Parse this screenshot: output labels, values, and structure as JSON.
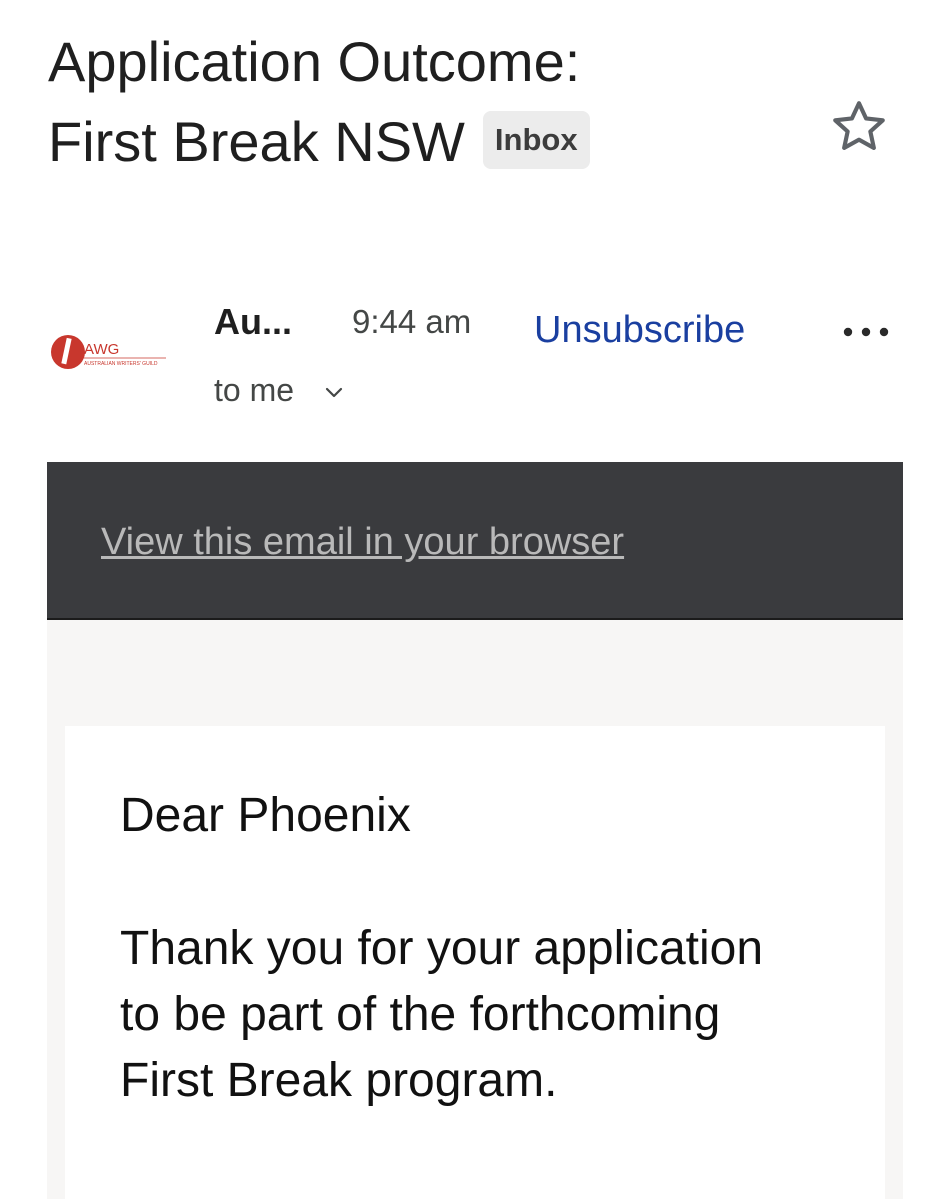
{
  "email": {
    "subject_line_1": "Application Outcome:",
    "subject_line_2": "First Break NSW",
    "label": "Inbox",
    "sender": "Au...",
    "time": "9:44 am",
    "unsubscribe": "Unsubscribe",
    "recipient": "to me",
    "avatar": {
      "logo_text": "AWG",
      "logo_subtext": "AUSTRALIAN WRITERS' GUILD",
      "brand_color": "#c8372d"
    }
  },
  "banner": {
    "view_in_browser": "View this email in your browser"
  },
  "content": {
    "greeting": "Dear Phoenix",
    "paragraph": "Thank you for your application to be part of the forthcoming First Break program."
  },
  "icons": {
    "star": "star-outline-icon",
    "more": "more-horizontal-icon",
    "chevron": "chevron-down-icon"
  },
  "colors": {
    "link_blue": "#1a3fa0",
    "banner_bg": "#3a3b3e",
    "badge_bg": "#ececec"
  }
}
